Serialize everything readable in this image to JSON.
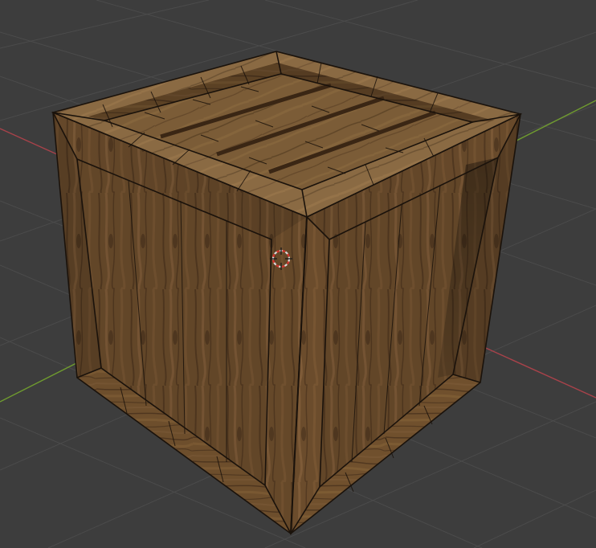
{
  "viewport": {
    "background": "#3d3d3d",
    "grid_color": "#4b4b4b",
    "x_axis_color": "#a8424a",
    "y_axis_color": "#6f9b2f",
    "object": "wooden-crate-mesh",
    "wood_colors": {
      "light": "#8a6640",
      "mid": "#6b4c2c",
      "dark": "#4a321c",
      "edge": "#1a120b"
    },
    "cursor_colors": [
      "#d9d9d9",
      "#d8342d"
    ]
  }
}
